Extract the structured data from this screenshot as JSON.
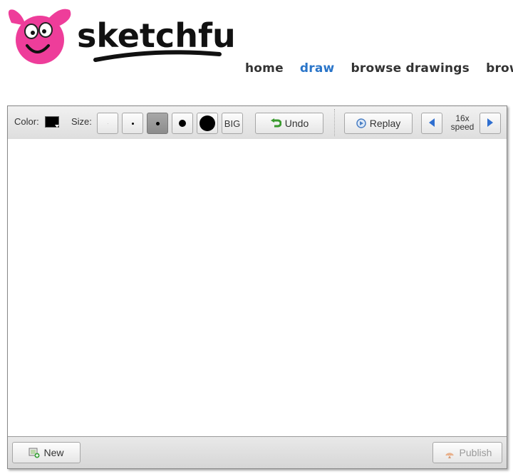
{
  "brand": {
    "name": "sketchfu"
  },
  "nav": {
    "items": [
      {
        "label": "home"
      },
      {
        "label": "draw",
        "active": true
      },
      {
        "label": "browse drawings"
      },
      {
        "label": "browse"
      }
    ]
  },
  "toolbar": {
    "color_label": "Color:",
    "current_color": "#000000",
    "size_label": "Size:",
    "sizes": [
      "tiny",
      "small",
      "medium",
      "large",
      "x-large"
    ],
    "selected_size_index": 2,
    "big_label": "BIG",
    "undo_label": "Undo",
    "replay_label": "Replay",
    "speed_value": "16x",
    "speed_label": "speed"
  },
  "footer": {
    "new_label": "New",
    "publish_label": "Publish"
  },
  "colors": {
    "accent_link": "#2a75c9",
    "logo_pink": "#ee3d9a",
    "arrow_blue": "#2f6fd0"
  }
}
